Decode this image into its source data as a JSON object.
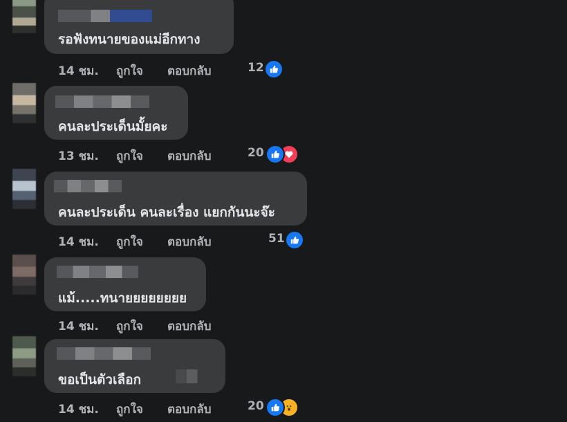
{
  "actions": {
    "like": "ถูกใจ",
    "reply": "ตอบกลับ"
  },
  "comments": [
    {
      "text": "รอฟังทนายของแม่อีกทาง",
      "time": "14 ชม.",
      "reaction_count": "12",
      "reactions": [
        "like-icon"
      ]
    },
    {
      "text": "คนละประเด็นมั้ยคะ",
      "time": "13 ชม.",
      "reaction_count": "20",
      "reactions": [
        "like-icon",
        "love-icon"
      ]
    },
    {
      "text": "คนละประเด็น คนละเรื่อง แยกกันนะจ๊ะ",
      "time": "14 ชม.",
      "reaction_count": "51",
      "reactions": [
        "like-icon"
      ]
    },
    {
      "text": "แม้.....ทนายยยยยยยย",
      "time": "14 ชม.",
      "reaction_count": "",
      "reactions": []
    },
    {
      "text": "ขอเป็นตัวเลือก",
      "time": "14 ชม.",
      "reaction_count": "20",
      "reactions": [
        "like-icon",
        "wow-icon"
      ]
    }
  ],
  "colors": {
    "background": "#18191a",
    "bubble": "#3a3b3c",
    "like": "#1877f2",
    "love": "#f33e58",
    "wow": "#f7b125"
  }
}
